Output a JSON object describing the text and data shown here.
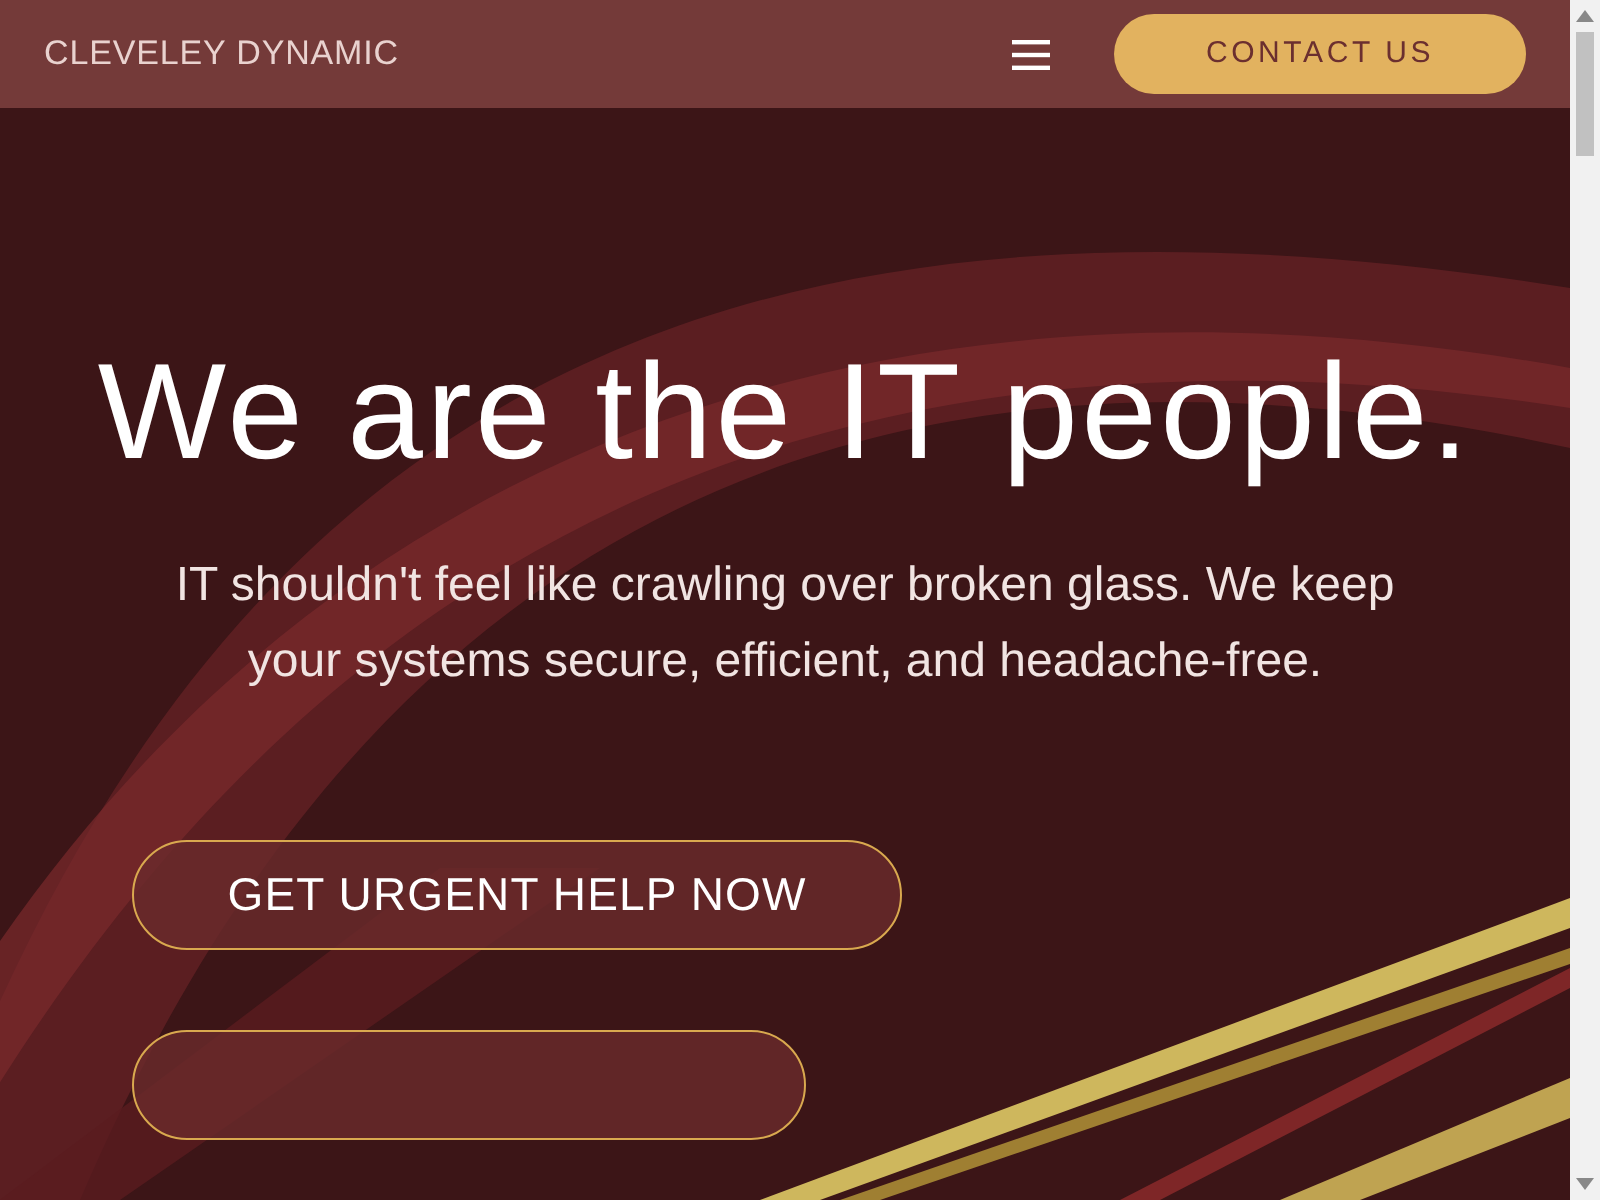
{
  "header": {
    "brand": "CLEVELEY DYNAMIC",
    "contact_button": "CONTACT US"
  },
  "hero": {
    "title": "We are the IT people.",
    "subtitle": "IT shouldn't feel like crawling over broken glass. We keep your systems secure, efficient, and headache-free.",
    "primary_button": "GET URGENT HELP NOW"
  }
}
